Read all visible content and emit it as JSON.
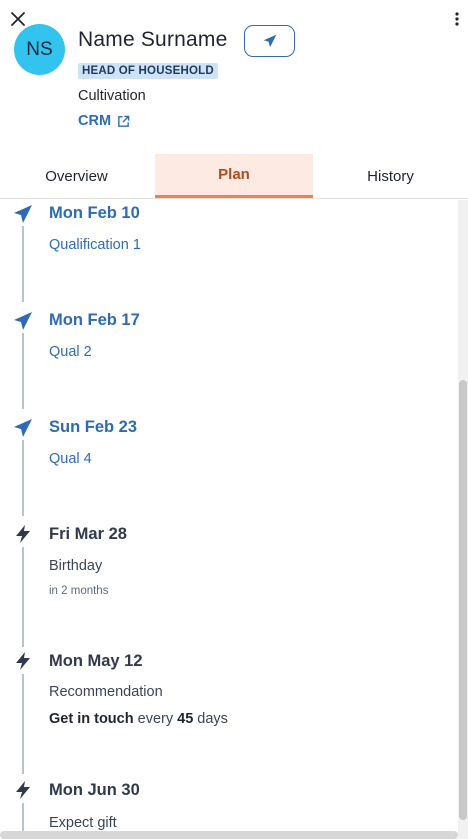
{
  "header": {
    "avatar_initials": "NS",
    "name": "Name Surname",
    "badge": "HEAD OF HOUSEHOLD",
    "stage": "Cultivation",
    "crm_link": "CRM"
  },
  "tabs": [
    {
      "label": "Overview",
      "active": false
    },
    {
      "label": "Plan",
      "active": true
    },
    {
      "label": "History",
      "active": false
    }
  ],
  "events": [
    {
      "icon": "send-icon",
      "date": "Mon Feb 10",
      "title": "Qualification 1"
    },
    {
      "icon": "send-icon",
      "date": "Mon Feb 17",
      "title": "Qual 2"
    },
    {
      "icon": "send-icon",
      "date": "Sun Feb 23",
      "title": "Qual 4"
    },
    {
      "icon": "lightning-icon",
      "date": "Fri Mar 28",
      "title": "Birthday",
      "note": "in 2 months"
    },
    {
      "icon": "lightning-icon",
      "date": "Mon May 12",
      "title": "Recommendation",
      "meta": {
        "prefix": "Get in touch",
        "middle": "every",
        "value": "45",
        "suffix": "days"
      }
    },
    {
      "icon": "lightning-icon",
      "date": "Mon Jun 30",
      "title": "Expect gift"
    }
  ],
  "colors": {
    "accent": "#2e6bb0",
    "avatar": "#33c3ef",
    "active_tab_bg": "#fdebe3",
    "active_tab_text": "#b04a1f",
    "active_tab_underline": "#e8844f",
    "badge_bg": "#cfe3f7"
  }
}
